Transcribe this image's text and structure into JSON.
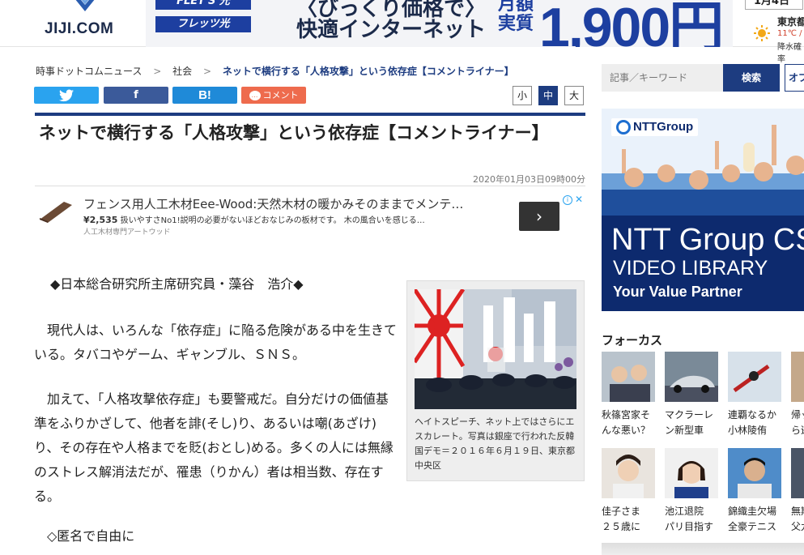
{
  "header": {
    "logo_text": "JIJI.COM",
    "ad": {
      "flets_top": "FLET'S 光",
      "flets_bottom": "フレッツ光",
      "line1": "〈びっくり価格で〉",
      "line2": "快適インターネット",
      "price_label": "月額実質",
      "price": "1,900円～"
    },
    "weather": {
      "date": "1月4日",
      "city": "東京都",
      "temp": "11℃ / ",
      "rain": "降水確率"
    }
  },
  "breadcrumb": {
    "home": "時事ドットコムニュース",
    "sep": ">",
    "category": "社会",
    "current": "ネットで横行する「人格攻撃」という依存症【コメントライナー】"
  },
  "share": {
    "twitter": "🐦",
    "facebook": "f",
    "hatena": "B!",
    "comment": "コメント",
    "comment_icon": "…"
  },
  "font_size": {
    "small": "小",
    "medium": "中",
    "large": "大"
  },
  "article": {
    "title": "ネットで横行する「人格攻撃」という依存症【コメントライナー】",
    "date": "2020年01月03日09時00分",
    "paragraphs": [
      "◆日本総合研究所主席研究員・藻谷　浩介◆",
      "現代人は、いろんな「依存症」に陥る危険がある中を生きている。タバコやゲーム、ギャンブル、ＳＮＳ。",
      "加えて、「人格攻撃依存症」も要警戒だ。自分だけの価値基準をふりかざして、他者を誹(そし)り、あるいは嘲(あざけ)り、その存在や人格までを貶(おとし)める。多くの人には無縁のストレス解消法だが、罹患（りかん）者は相当数、存在する。",
      "◇匿名で自由に"
    ],
    "photo_caption": "ヘイトスピーチ、ネット上ではさらにエスカレート。写真は銀座で行われた反韓国デモ＝２０１６年６月１９日、東京都中央区"
  },
  "native_ad": {
    "title": "フェンス用人工木材Eee-Wood:天然木材の暖かみそのままでメンテ…",
    "price": "¥2,535",
    "desc": " 扱いやすさNo1!説明の必要がないほどおなじみの板材です。 木の風合いを感じる…",
    "source": "人工木材専門アートウッド",
    "arrow": "›",
    "info": "i",
    "close": "✕"
  },
  "sidebar": {
    "search_placeholder": "記事／キーワード",
    "search_button": "検索",
    "option_button": "オプ",
    "ntt_ad": {
      "logo": "NTTGroup",
      "big": "NTT Group CS",
      "sub": "VIDEO LIBRARY",
      "tagline": "Your Value Partner"
    },
    "focus_title": "フォーカス",
    "focus_items": [
      {
        "line1": "秋篠宮家そ",
        "line2": "んな悪い？"
      },
      {
        "line1": "マクラーレ",
        "line2": "ン新型車"
      },
      {
        "line1": "連覇なるか",
        "line2": "小林陵侑"
      },
      {
        "line1": "帰ッ",
        "line2": "ら逃"
      },
      {
        "line1": "佳子さま",
        "line2": "２５歳に"
      },
      {
        "line1": "池江退院",
        "line2": "パリ目指す"
      },
      {
        "line1": "錦織圭欠場",
        "line2": "全豪テニス"
      },
      {
        "line1": "無期",
        "line2": "父九"
      }
    ]
  },
  "colors": {
    "brand_navy": "#1d3c80",
    "twitter": "#2aa3ef",
    "facebook": "#3b5a9a",
    "hatena": "#1f8ad8",
    "comment": "#ee6b4d"
  }
}
